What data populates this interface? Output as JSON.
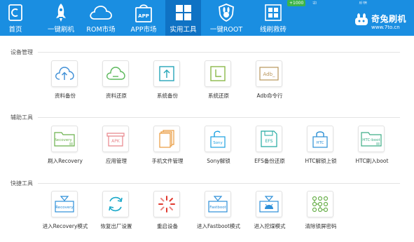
{
  "topbar": {
    "nav_items": [
      {
        "label": "首页",
        "icon": "home-icon"
      },
      {
        "label": "一键刷机",
        "icon": "rocket-icon"
      },
      {
        "label": "ROM市场",
        "icon": "cloud-icon"
      },
      {
        "label": "APP市场",
        "icon": "app-bag-icon"
      },
      {
        "label": "实用工具",
        "icon": "grid-tools-icon",
        "active": true
      },
      {
        "label": "一键ROOT",
        "icon": "rabbit-shield-icon"
      },
      {
        "label": "线刷救砖",
        "icon": "brick-grid-icon"
      }
    ],
    "badge": "+1000",
    "logo": {
      "name": "奇兔刷机",
      "url": "www.7to.cn"
    },
    "window_controls": {
      "feedback": "反馈",
      "user": "迎"
    }
  },
  "sections": [
    {
      "title": "设备管理",
      "tools": [
        {
          "label": "资料备份",
          "icon": "cloud-upload-icon",
          "color": "#3f8fd6"
        },
        {
          "label": "资料还原",
          "icon": "cloud-restore-icon",
          "color": "#5cb85c"
        },
        {
          "label": "系统备份",
          "icon": "system-backup-icon",
          "color": "#26a6b8"
        },
        {
          "label": "系统还原",
          "icon": "system-restore-icon",
          "color": "#8cb84a"
        },
        {
          "label": "Adb命令行",
          "icon": "adb-terminal-icon",
          "color": "#b8955a",
          "glyph": "Adb_"
        }
      ]
    },
    {
      "title": "辅助工具",
      "tools": [
        {
          "label": "刷入Recovery",
          "icon": "recovery-folder-icon",
          "color": "#6ab04c",
          "glyph": "Recovery"
        },
        {
          "label": "应用管理",
          "icon": "apk-box-icon",
          "color": "#e8868c",
          "glyph": "APK"
        },
        {
          "label": "手机文件管理",
          "icon": "file-manager-icon",
          "color": "#e89a3c"
        },
        {
          "label": "Sony解锁",
          "icon": "sony-unlock-icon",
          "color": "#1a9fe0",
          "glyph": "Sony"
        },
        {
          "label": "EFS备份还原",
          "icon": "efs-floppy-icon",
          "color": "#21a9a0",
          "glyph": "EFS"
        },
        {
          "label": "HTC解锁上锁",
          "icon": "htc-lock-icon",
          "color": "#2b8fd4",
          "glyph": "HTC"
        },
        {
          "label": "HTC刷入boot",
          "icon": "htc-boot-icon",
          "color": "#3fae86",
          "glyph": "HTC-boot"
        }
      ]
    },
    {
      "title": "快捷工具",
      "tools": [
        {
          "label": "进入Recovery模式",
          "icon": "recovery-mode-icon",
          "color": "#2d8fd8",
          "glyph": "Recovery"
        },
        {
          "label": "恢复出厂设置",
          "icon": "factory-reset-icon",
          "color": "#19a8c9"
        },
        {
          "label": "重启设备",
          "icon": "reboot-icon",
          "color": "#e0392f"
        },
        {
          "label": "进入Fastboot模式",
          "icon": "fastboot-mode-icon",
          "color": "#2d8fd8",
          "glyph": "Fastboot"
        },
        {
          "label": "进入挖煤模式",
          "icon": "android-download-icon",
          "color": "#2d8fd8"
        },
        {
          "label": "清除锁屏密码",
          "icon": "pattern-lock-icon",
          "color": "#6ab04c"
        }
      ]
    }
  ]
}
